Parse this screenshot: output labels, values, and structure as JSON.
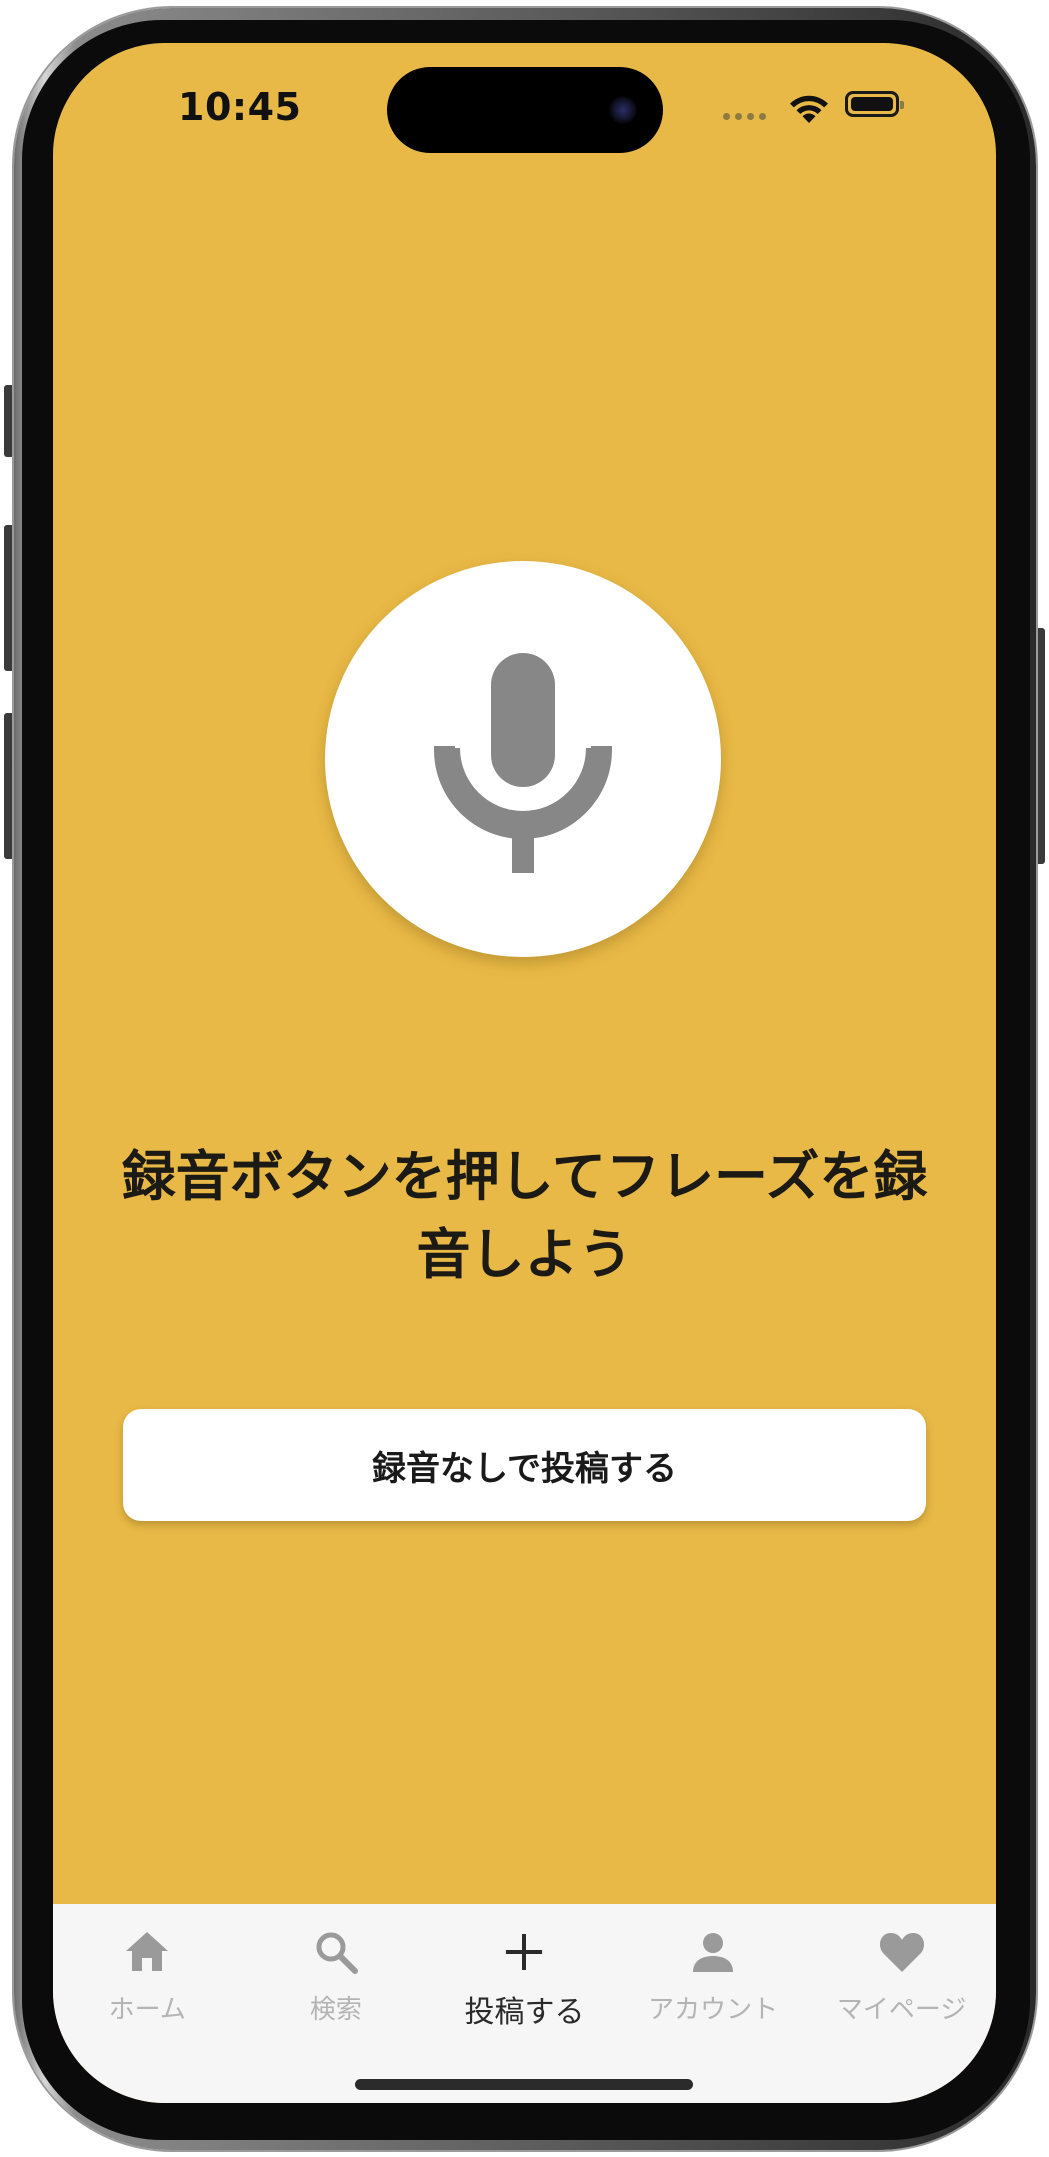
{
  "status_bar": {
    "time": "10:45"
  },
  "recorder": {
    "mic_icon": "microphone-icon",
    "instruction": "録音ボタンを押してフレーズを録音しよう",
    "post_without_recording_label": "録音なしで投稿する"
  },
  "tab_bar": {
    "items": [
      {
        "label": "ホーム",
        "icon": "home-icon",
        "active": false
      },
      {
        "label": "検索",
        "icon": "search-icon",
        "active": false
      },
      {
        "label": "投稿する",
        "icon": "plus-icon",
        "active": true
      },
      {
        "label": "アカウント",
        "icon": "person-icon",
        "active": false
      },
      {
        "label": "マイページ",
        "icon": "heart-icon",
        "active": false
      }
    ]
  },
  "colors": {
    "background": "#e8b946",
    "card": "#ffffff",
    "icon_gray": "#878787",
    "tab_inactive": "#b4b4b4",
    "tab_active": "#2a2a2a"
  }
}
